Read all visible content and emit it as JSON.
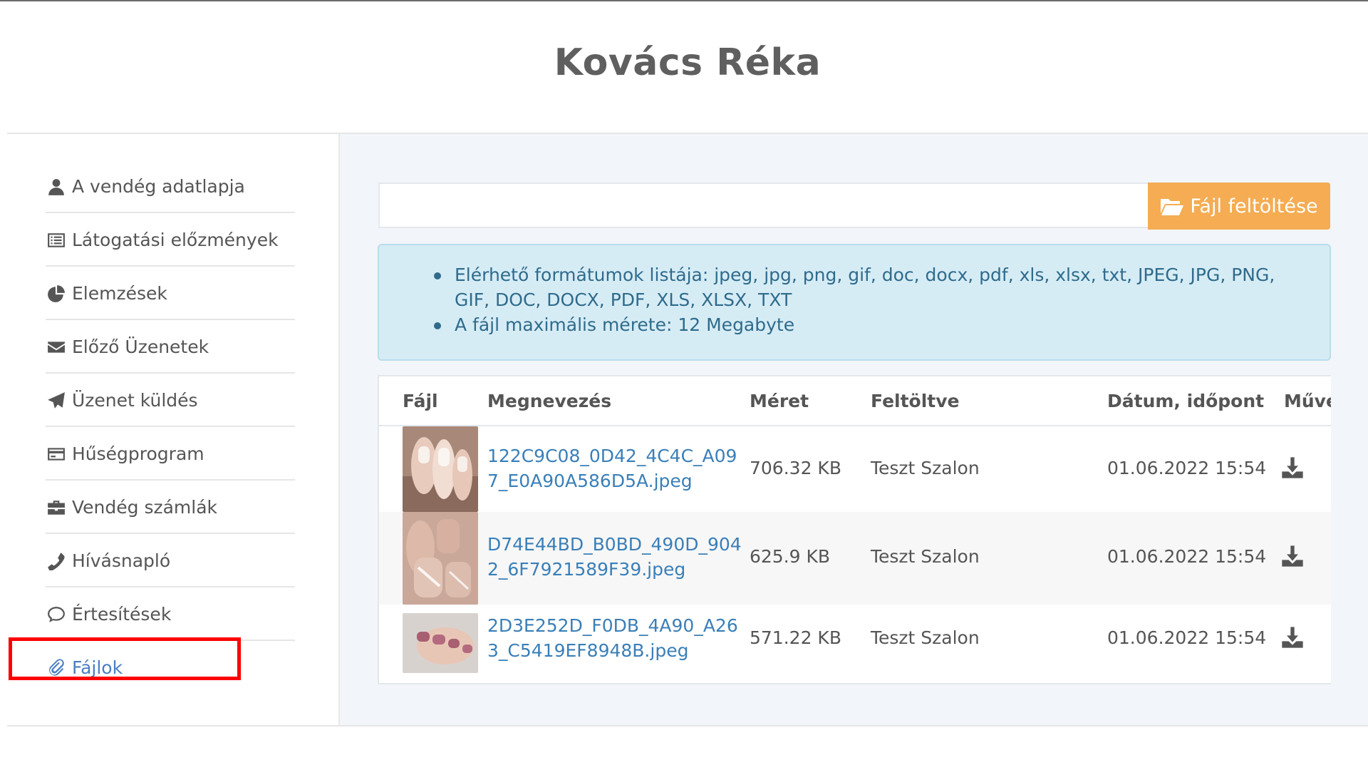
{
  "page": {
    "title": "Kovács Réka"
  },
  "sidebar": {
    "items": [
      {
        "label": "A vendég adatlapja",
        "icon": "user-icon"
      },
      {
        "label": "Látogatási előzmények",
        "icon": "list-icon"
      },
      {
        "label": "Elemzések",
        "icon": "pie-chart-icon"
      },
      {
        "label": "Előző Üzenetek",
        "icon": "envelope-icon"
      },
      {
        "label": "Üzenet küldés",
        "icon": "paper-plane-icon"
      },
      {
        "label": "Hűségprogram",
        "icon": "credit-card-icon"
      },
      {
        "label": "Vendég számlák",
        "icon": "briefcase-icon"
      },
      {
        "label": "Hívásnapló",
        "icon": "phone-icon"
      },
      {
        "label": "Értesítések",
        "icon": "comment-icon"
      },
      {
        "label": "Fájlok",
        "icon": "paperclip-icon",
        "active": true
      }
    ]
  },
  "upload": {
    "button_label": "Fájl feltöltése",
    "icon": "folder-open-icon"
  },
  "info": {
    "formats": "Elérhető formátumok listája: jpeg, jpg, png, gif, doc, docx, pdf, xls, xlsx, txt, JPEG, JPG, PNG, GIF, DOC, DOCX, PDF, XLS, XLSX, TXT",
    "max_size": "A fájl maximális mérete: 12 Megabyte"
  },
  "table": {
    "headers": [
      "Fájl",
      "Megnevezés",
      "Méret",
      "Feltöltve",
      "Dátum, időpont",
      "Műve"
    ],
    "rows": [
      {
        "name": "122C9C08_0D42_4C4C_A097_E0A90A586D5A.jpeg",
        "size": "706.32 KB",
        "uploaded_by": "Teszt Szalon",
        "datetime": "01.06.2022 15:54"
      },
      {
        "name": "D74E44BD_B0BD_490D_9042_6F7921589F39.jpeg",
        "size": "625.9 KB",
        "uploaded_by": "Teszt Szalon",
        "datetime": "01.06.2022 15:54"
      },
      {
        "name": "2D3E252D_F0DB_4A90_A263_C5419EF8948B.jpeg",
        "size": "571.22 KB",
        "uploaded_by": "Teszt Szalon",
        "datetime": "01.06.2022 15:54"
      }
    ]
  },
  "colors": {
    "accent_orange": "#f5ac52",
    "link_blue": "#3a7fb8",
    "info_bg": "#d6ecf5",
    "highlight_red": "#ff0000"
  }
}
